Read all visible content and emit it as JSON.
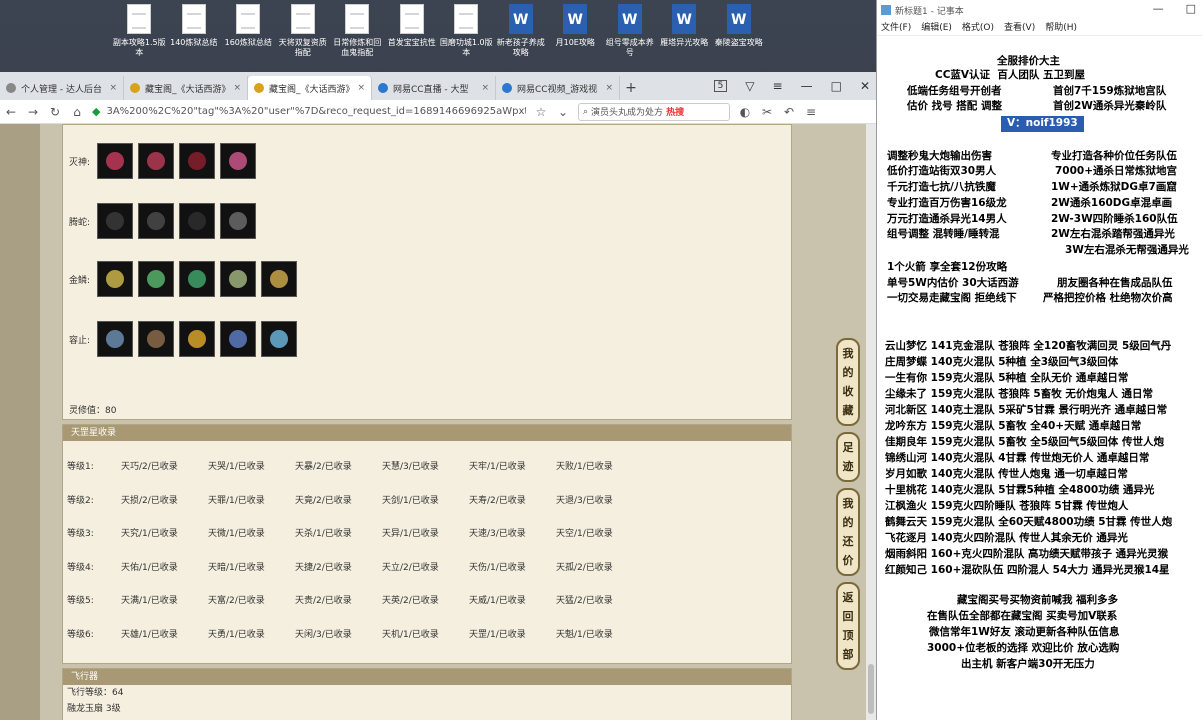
{
  "desktop": {
    "icons": [
      {
        "label": "副本攻略1.5版本",
        "type": "doc"
      },
      {
        "label": "140炼狱总结",
        "type": "doc"
      },
      {
        "label": "160炼狱总结",
        "type": "doc"
      },
      {
        "label": "天将双复资质指配",
        "type": "doc"
      },
      {
        "label": "日常修炼和回血鬼指配",
        "type": "doc"
      },
      {
        "label": "首发宝宝抗性",
        "type": "doc"
      },
      {
        "label": "国磨功城1.0版本",
        "type": "doc"
      },
      {
        "label": "新老孩子养成攻略",
        "type": "word"
      },
      {
        "label": "月10E攻略",
        "type": "word"
      },
      {
        "label": "组号零成本养号",
        "type": "word"
      },
      {
        "label": "雁塔异光攻略",
        "type": "word"
      },
      {
        "label": "秦陵盗宝攻略",
        "type": "word"
      }
    ]
  },
  "browser": {
    "tabs": [
      {
        "label": "个人管理 - 达人后台",
        "color": "#888888"
      },
      {
        "label": "藏宝阁_《大话西游》",
        "color": "#d9a21b"
      },
      {
        "label": "藏宝阁_《大话西游》",
        "color": "#d9a21b",
        "active": true
      },
      {
        "label": "网易CC直播 - 大型",
        "color": "#2a78d0"
      },
      {
        "label": "网易CC视频_游戏视",
        "color": "#2a78d0"
      }
    ],
    "new_tab": "+",
    "tab_count": "5",
    "url": "3A%200%2C%20\"tag\"%3A%20\"user\"%7D&reco_request_id=1689146696925aWpxt",
    "search_text": "演员头丸成为处方",
    "search_hot": "热搜"
  },
  "page": {
    "rows": [
      {
        "label": "灭神:",
        "colors": [
          "#c0395b",
          "#b43a56",
          "#8a1e2e",
          "#c9558a"
        ]
      },
      {
        "label": "腾蛇:",
        "colors": [
          "#3a3a3a",
          "#4a4a4a",
          "#2e2e2e",
          "#6a6a6a"
        ]
      },
      {
        "label": "金鳞:",
        "colors": [
          "#c9b34a",
          "#57b06b",
          "#3fa26a",
          "#9fb07a",
          "#c9a44a"
        ]
      },
      {
        "label": "容止:",
        "colors": [
          "#6a8db0",
          "#8a6a4a",
          "#d6a32a",
          "#5a7ac0",
          "#6ab0d6"
        ]
      }
    ],
    "lingxiu": "灵修值：80",
    "collection_title": "天罡星收录",
    "collection": [
      {
        "level": "等级1:",
        "cells": [
          "天巧/2/已收录",
          "天哭/1/已收录",
          "天暴/2/已收录",
          "天慧/3/已收录",
          "天牢/1/已收录",
          "天败/1/已收录"
        ]
      },
      {
        "level": "等级2:",
        "cells": [
          "天损/2/已收录",
          "天罪/1/已收录",
          "天竟/2/已收录",
          "天剑/1/已收录",
          "天寿/2/已收录",
          "天退/3/已收录"
        ]
      },
      {
        "level": "等级3:",
        "cells": [
          "天究/1/已收录",
          "天微/1/已收录",
          "天杀/1/已收录",
          "天异/1/已收录",
          "天速/3/已收录",
          "天空/1/已收录"
        ]
      },
      {
        "level": "等级4:",
        "cells": [
          "天佑/1/已收录",
          "天暗/1/已收录",
          "天捷/2/已收录",
          "天立/2/已收录",
          "天伤/1/已收录",
          "天孤/2/已收录"
        ]
      },
      {
        "level": "等级5:",
        "cells": [
          "天满/1/已收录",
          "天富/2/已收录",
          "天贵/2/已收录",
          "天英/2/已收录",
          "天威/1/已收录",
          "天猛/2/已收录"
        ]
      },
      {
        "level": "等级6:",
        "cells": [
          "天雄/1/已收录",
          "天勇/1/已收录",
          "天闲/3/已收录",
          "天机/1/已收录",
          "天罡/1/已收录",
          "天魁/1/已收录"
        ]
      }
    ],
    "flight_title": "飞行器",
    "flight_level": "飞行等级：64",
    "dragon_jade": "融龙玉扇  3级",
    "side_buttons": [
      "我的收藏",
      "足迹",
      "我的还价",
      "返回顶部"
    ]
  },
  "notepad": {
    "title": "新标题1 - 记事本",
    "menu": [
      "文件(F)",
      "编辑(E)",
      "格式(O)",
      "查看(V)",
      "帮助(H)"
    ],
    "lines": [
      "全服排价大主",
      "CC蓝V认证  百人团队 五卫到屋",
      "低端任务组号开创者",
      "首创7千159炼狱地宫队",
      "估价 找号 搭配 调整",
      "首创2W通杀异光秦岭队",
      "V：noif1993",
      "调整秒鬼大炮输出伤害",
      "专业打造各种价位任务队伍",
      "低价打造站街双30男人",
      "7000+通杀日常炼狱地宫",
      "千元打造七抗/八抗铁魔",
      "1W+通杀炼狱DG卓7画窟",
      "专业打造百万伤害16级龙",
      "2W通杀160DG卓混卓画",
      "万元打造通杀异光14男人",
      "2W-3W四阶睡杀160队伍",
      "组号调整 混转睡/睡转混",
      "2W左右混杀踏帮强通异光",
      "3W左右混杀无帮强通异光",
      "1个火箭 享全套12份攻略",
      "单号5W内估价 30大话西游",
      "朋友圈各种在售成品队伍",
      "一切交易走藏宝阁 拒绝线下",
      "严格把控价格 杜绝物次价高",
      "云山梦忆 141克金混队 苍狼阵 全120畜牧满回灵 5级回气丹",
      "庄周梦蝶 140克火混队 5种植 全3级回气3级回体",
      "一生有你 159克火混队 5种植 全队无价 通卓越日常",
      "尘缘未了 159克火混队 苍狼阵 5畜牧 无价炮鬼人 通日常",
      "河北新区 140克土混队 5采矿5甘霖 景行明光齐 通卓越日常",
      "龙吟东方 159克火混队 5畜牧 全40+天赋 通卓越日常",
      "佳期良年 159克火混队 5畜牧 全5级回气5级回体 传世人炮",
      "锦绣山河 140克火混队 4甘霖 传世炮无价人 通卓越日常",
      "岁月如歌 140克火混队 传世人炮鬼 通一切卓越日常",
      "十里桃花 140克火混队 5甘霖5种植 全4800功绩 通异光",
      "江枫渔火 159克火四阶睡队 苍狼阵 5甘霖 传世炮人",
      "鹤舞云天 159克火混队 全60天赋4800功绩 5甘霖 传世人炮",
      "飞花逐月 140克火四阶混队 传世人其余无价 通异光",
      "烟雨斜阳 160+克火四阶混队 高功绩天赋带孩子 通异光灵猴",
      "红颜知己 160+混砍队伍 四阶混人 54大力 通异光灵猴14星",
      "藏宝阁买号买物资前喊我 福利多多",
      "在售队伍全部都在藏宝阁 买卖号加V联系",
      "微信常年1W好友 滚动更新各种队伍信息",
      "3000+位老板的选择 欢迎比价 放心选购",
      "出主机 新客户端30开无压力"
    ]
  }
}
